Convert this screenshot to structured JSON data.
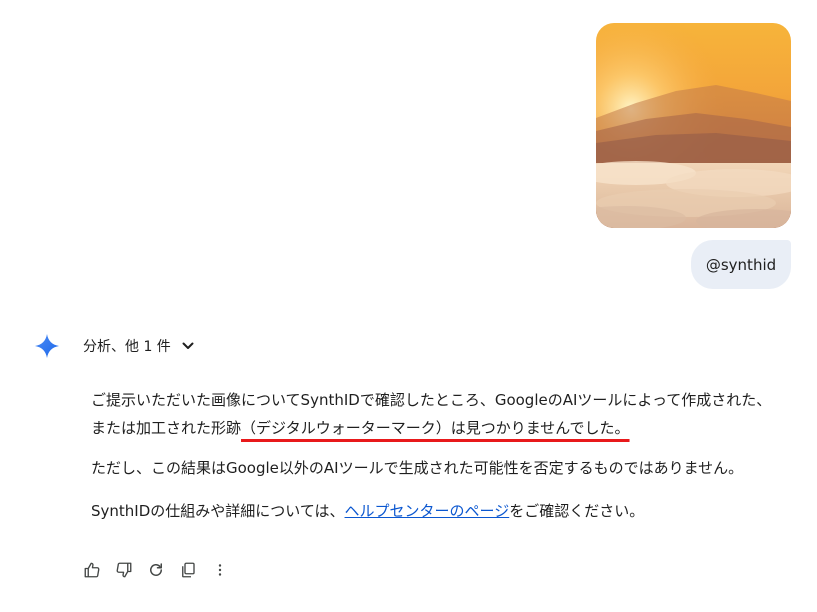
{
  "user_message": {
    "image_icon": "sunrise-mountain-clouds-photo",
    "text": "@synthid"
  },
  "response": {
    "analysis_label": "分析、他 1 件",
    "p1_before": "ご提示いただいた画像についてSynthIDで確認したところ、GoogleのAIツールによって作成された、または加工された形跡",
    "p1_highlight": "（デジタルウォーターマーク）は見つかりませんでした。",
    "p2": "ただし、この結果はGoogle以外のAIツールで生成された可能性を否定するものではありません。",
    "p3_before": "SynthIDの仕組みや詳細については、",
    "p3_link": "ヘルプセンターのページ",
    "p3_after": "をご確認ください。"
  },
  "actions": [
    "thumbs-up-icon",
    "thumbs-down-icon",
    "regenerate-icon",
    "copy-icon",
    "more-vert-icon"
  ],
  "colors": {
    "accent_link": "#0b57d0",
    "highlight_underline": "#e8191b",
    "user_bubble": "#e9eef6",
    "gem_blue": "#4285f4"
  }
}
